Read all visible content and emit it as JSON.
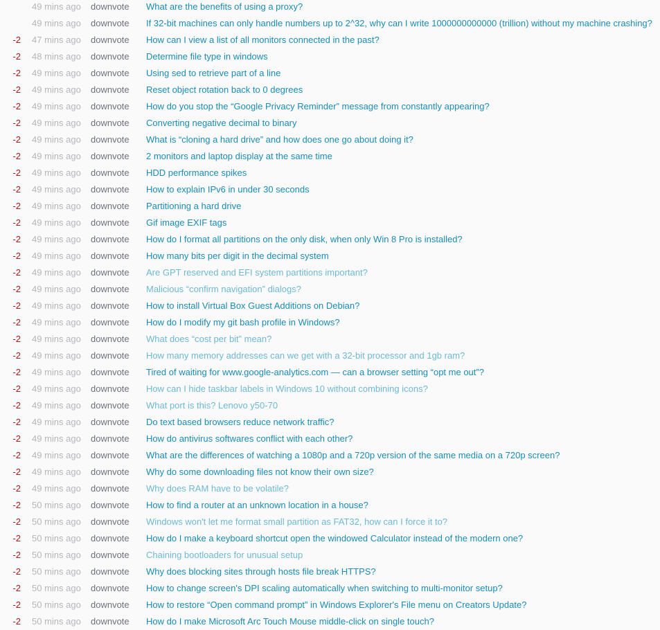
{
  "colors": {
    "score": "#a3191c",
    "time": "#b4b6b9",
    "action": "#6a737c",
    "link": "#1a8cb5",
    "link_visited": "#6db9d3",
    "background": "#fafafb"
  },
  "rows": [
    {
      "score": "",
      "time": "49 mins ago",
      "action": "downvote",
      "title": "What are the benefits of using a proxy?",
      "visited": false
    },
    {
      "score": "",
      "time": "49 mins ago",
      "action": "downvote",
      "title": "If 32-bit machines can only handle numbers up to 2^32, why can I write 1000000000000 (trillion) without my machine crashing?",
      "visited": false
    },
    {
      "score": "-2",
      "time": "47 mins ago",
      "action": "downvote",
      "title": "How can I view a list of all monitors connected in the past?",
      "visited": false
    },
    {
      "score": "-2",
      "time": "48 mins ago",
      "action": "downvote",
      "title": "Determine file type in windows",
      "visited": false
    },
    {
      "score": "-2",
      "time": "49 mins ago",
      "action": "downvote",
      "title": "Using sed to retrieve part of a line",
      "visited": false
    },
    {
      "score": "-2",
      "time": "49 mins ago",
      "action": "downvote",
      "title": "Reset object rotation back to 0 degrees",
      "visited": false
    },
    {
      "score": "-2",
      "time": "49 mins ago",
      "action": "downvote",
      "title": "How do you stop the “Google Privacy Reminder” message from constantly appearing?",
      "visited": false
    },
    {
      "score": "-2",
      "time": "49 mins ago",
      "action": "downvote",
      "title": "Converting negative decimal to binary",
      "visited": false
    },
    {
      "score": "-2",
      "time": "49 mins ago",
      "action": "downvote",
      "title": "What is “cloning a hard drive” and how does one go about doing it?",
      "visited": false
    },
    {
      "score": "-2",
      "time": "49 mins ago",
      "action": "downvote",
      "title": "2 monitors and laptop display at the same time",
      "visited": false
    },
    {
      "score": "-2",
      "time": "49 mins ago",
      "action": "downvote",
      "title": "HDD performance spikes",
      "visited": false
    },
    {
      "score": "-2",
      "time": "49 mins ago",
      "action": "downvote",
      "title": "How to explain IPv6 in under 30 seconds",
      "visited": false
    },
    {
      "score": "-2",
      "time": "49 mins ago",
      "action": "downvote",
      "title": "Partitioning a hard drive",
      "visited": false
    },
    {
      "score": "-2",
      "time": "49 mins ago",
      "action": "downvote",
      "title": "Gif image EXIF tags",
      "visited": false
    },
    {
      "score": "-2",
      "time": "49 mins ago",
      "action": "downvote",
      "title": "How do I format all partitions on the only disk, when only Win 8 Pro is installed?",
      "visited": false
    },
    {
      "score": "-2",
      "time": "49 mins ago",
      "action": "downvote",
      "title": "How many bits per digit in the decimal system",
      "visited": false
    },
    {
      "score": "-2",
      "time": "49 mins ago",
      "action": "downvote",
      "title": "Are GPT reserved and EFI system partitions important?",
      "visited": true
    },
    {
      "score": "-2",
      "time": "49 mins ago",
      "action": "downvote",
      "title": "Malicious “confirm navigation” dialogs?",
      "visited": true
    },
    {
      "score": "-2",
      "time": "49 mins ago",
      "action": "downvote",
      "title": "How to install Virtual Box Guest Additions on Debian?",
      "visited": false
    },
    {
      "score": "-2",
      "time": "49 mins ago",
      "action": "downvote",
      "title": "How do I modify my git bash profile in Windows?",
      "visited": false
    },
    {
      "score": "-2",
      "time": "49 mins ago",
      "action": "downvote",
      "title": "What does “cost per bit” mean?",
      "visited": true
    },
    {
      "score": "-2",
      "time": "49 mins ago",
      "action": "downvote",
      "title": "How many memory addresses can we get with a 32-bit processor and 1gb ram?",
      "visited": true
    },
    {
      "score": "-2",
      "time": "49 mins ago",
      "action": "downvote",
      "title": "Tired of waiting for www.google-analytics.com — can a browser setting “opt me out”?",
      "visited": false
    },
    {
      "score": "-2",
      "time": "49 mins ago",
      "action": "downvote",
      "title": "How can I hide taskbar labels in Windows 10 without combining icons?",
      "visited": true
    },
    {
      "score": "-2",
      "time": "49 mins ago",
      "action": "downvote",
      "title": "What port is this? Lenovo y50-70",
      "visited": true
    },
    {
      "score": "-2",
      "time": "49 mins ago",
      "action": "downvote",
      "title": "Do text based browsers reduce network traffic?",
      "visited": false
    },
    {
      "score": "-2",
      "time": "49 mins ago",
      "action": "downvote",
      "title": "How do antivirus softwares conflict with each other?",
      "visited": false
    },
    {
      "score": "-2",
      "time": "49 mins ago",
      "action": "downvote",
      "title": "What are the differences of watching a 1080p and a 720p version of the same media on a 720p screen?",
      "visited": false
    },
    {
      "score": "-2",
      "time": "49 mins ago",
      "action": "downvote",
      "title": "Why do some downloading files not know their own size?",
      "visited": false
    },
    {
      "score": "-2",
      "time": "49 mins ago",
      "action": "downvote",
      "title": "Why does RAM have to be volatile?",
      "visited": true
    },
    {
      "score": "-2",
      "time": "50 mins ago",
      "action": "downvote",
      "title": "How to find a router at an unknown location in a house?",
      "visited": false
    },
    {
      "score": "-2",
      "time": "50 mins ago",
      "action": "downvote",
      "title": "Windows won't let me format small partition as FAT32, how can I force it to?",
      "visited": true
    },
    {
      "score": "-2",
      "time": "50 mins ago",
      "action": "downvote",
      "title": "How do I make a keyboard shortcut open the windowed Calculator instead of the modern one?",
      "visited": false
    },
    {
      "score": "-2",
      "time": "50 mins ago",
      "action": "downvote",
      "title": "Chaining bootloaders for unusual setup",
      "visited": true
    },
    {
      "score": "-2",
      "time": "50 mins ago",
      "action": "downvote",
      "title": "Why does blocking sites through hosts file break HTTPS?",
      "visited": false
    },
    {
      "score": "-2",
      "time": "50 mins ago",
      "action": "downvote",
      "title": "How to change screen's DPI scaling automatically when switching to multi-monitor setup?",
      "visited": false
    },
    {
      "score": "-2",
      "time": "50 mins ago",
      "action": "downvote",
      "title": "How to restore “Open command prompt” in Windows Explorer's File menu on Creators Update?",
      "visited": false
    },
    {
      "score": "-2",
      "time": "50 mins ago",
      "action": "downvote",
      "title": "How do I make Microsoft Arc Touch Mouse middle-click on single touch?",
      "visited": false
    }
  ]
}
